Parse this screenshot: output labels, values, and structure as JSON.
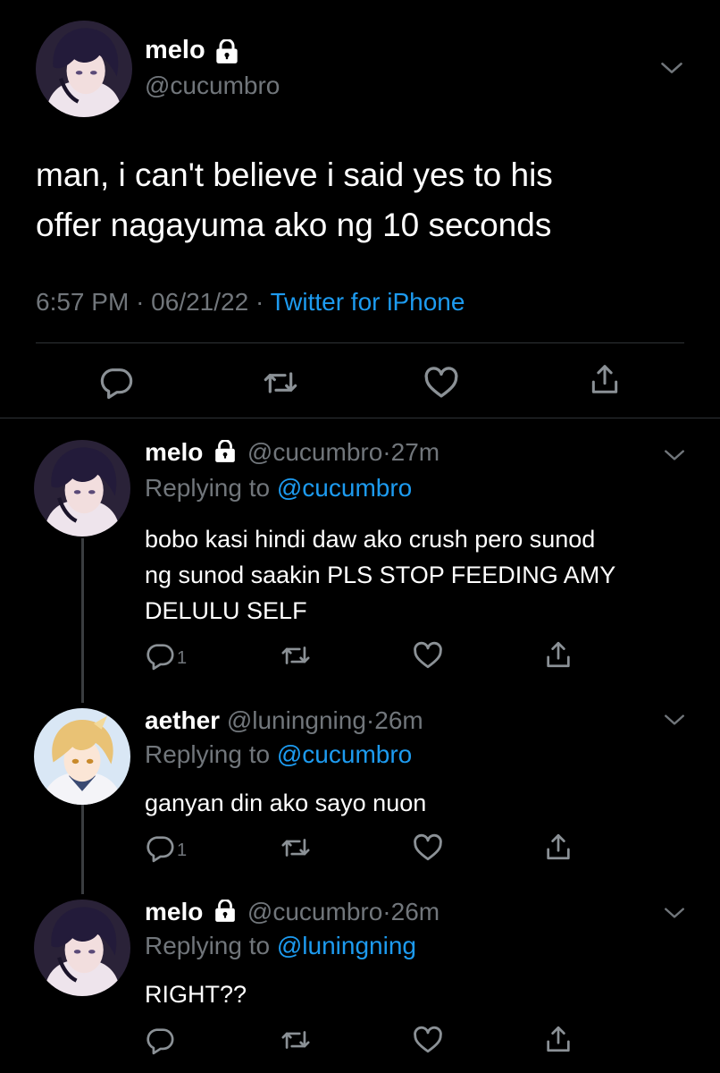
{
  "colors": {
    "background": "#000000",
    "text": "#ffffff",
    "secondary": "#71767b",
    "link": "#1d9bf0",
    "divider": "#2f3336"
  },
  "main_tweet": {
    "display_name": "melo",
    "handle": "@cucumbro",
    "text_line1": "man, i can't believe i said yes to his",
    "text_line2": "offer nagayuma ako ng 10 seconds",
    "time": "6:57 PM",
    "sep1": "·",
    "date": "06/21/22",
    "sep2": "·",
    "source": "Twitter for iPhone",
    "locked": true,
    "actions": [
      "reply-icon",
      "retweet-icon",
      "like-icon",
      "share-icon"
    ]
  },
  "replies": [
    {
      "display_name": "melo",
      "handle": "@cucumbro",
      "time": "27m",
      "locked": true,
      "replying_label": "Replying to",
      "replying_to": "@cucumbro",
      "text_lines": [
        "bobo kasi hindi daw ako crush pero sunod",
        "ng sunod saakin PLS STOP FEEDING AMY",
        "DELULU SELF"
      ],
      "reply_count": "1"
    },
    {
      "display_name": "aether",
      "handle": "@luningning",
      "time": "26m",
      "locked": false,
      "replying_label": "Replying to",
      "replying_to": "@cucumbro",
      "text_lines": [
        "ganyan din ako sayo nuon"
      ],
      "reply_count": "1"
    },
    {
      "display_name": "melo",
      "handle": "@cucumbro",
      "time": "26m",
      "locked": true,
      "replying_label": "Replying to",
      "replying_to": "@luningning",
      "text_lines": [
        "RIGHT??"
      ],
      "reply_count": ""
    }
  ]
}
